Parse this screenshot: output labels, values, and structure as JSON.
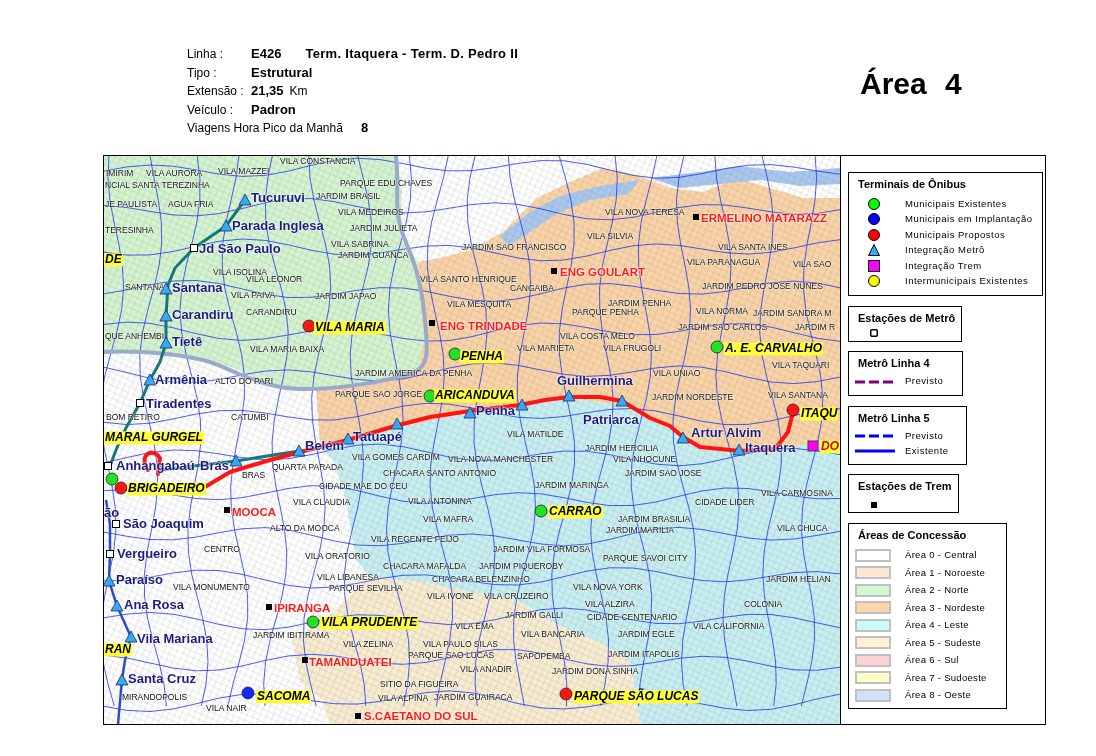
{
  "header": {
    "rows": [
      {
        "label": "Linha :",
        "value": "E426",
        "detail": "Term. Itaquera - Term. D. Pedro II"
      },
      {
        "label": "Tipo :",
        "value": "Estrutural"
      },
      {
        "label": "Extensão :",
        "value": "21,35",
        "unit": "Km"
      },
      {
        "label": "Veículo :",
        "value": "Padron"
      },
      {
        "label": "Viagens Hora Pico da Manhã",
        "value": "8"
      }
    ]
  },
  "area_title": "Área 4",
  "map": {
    "neighborhoods": [
      "VILA CONSTANCIA",
      "IMIRIM",
      "VILA AURORA",
      "VILA MAZZEI",
      "NCIAL SANTA TEREZINHA",
      "PARQUE EDU CHAVES",
      "JARDIM BRASIL",
      "JE PAULISTA",
      "AGUA FRIA",
      "VILA MEDEIROS",
      "VILA NOVA TERESA",
      "TERESINHA",
      "JARDIM JULIETA",
      "VILA SILVIA",
      "VILA SABRINA",
      "JARDIM SAO FRANCISCO",
      "VILA SANTA INES",
      "JARDIM GUANCA",
      "VILA PARANAGUA",
      "VILA SAO",
      "VILA ISOLINA",
      "VILA LEONOR",
      "VILA SANTO HENRIQUE",
      "SANTANA",
      "CANGAIBA",
      "JARDIM PEDRO JOSE NUNES",
      "VILA PAIVA",
      "JARDIM JAPAO",
      "VILA MESQUITA",
      "JARDIM PENHA",
      "CARANDIRU",
      "PARQUE PENHA",
      "VILA NORMA",
      "JARDIM SANDRA M",
      "JARDIM SAO CARLOS",
      "JARDIM R",
      "QUE ANHEMBI",
      "VILA COSTA MELO",
      "VILA MARIA BAIXA",
      "VILA MARIETA",
      "VILA FRUGOLI",
      "VILA TAQUARI",
      "JARDIM AMERICA DA PENHA",
      "VILA UNIAO",
      "ALTO DO PARI",
      "PARQUE SAO JORGE",
      "JARDIM NORDESTE",
      "VILA SANTANA",
      "BOM RETIRO",
      "CATUMBI",
      "VILA MATILDE",
      "JARDIM HERCILIA",
      "VILA GOMES CARDIM",
      "VILA NOVA MANCHESTER",
      "VILA NHOCUNE",
      "QUARTA PARADA",
      "BRAS",
      "CHACARA SANTO ANTONIO",
      "JARDIM SAO JOSE",
      "CIDADE MAE DO CEU",
      "JARDIM MARINGA",
      "VILA CARMOSINA",
      "VILA CLAUDIA",
      "VILA ANTONINA",
      "CIDADE LIDER",
      "VILA MAFRA",
      "JARDIM BRASILIA",
      "ALTO DA MOOCA",
      "JARDIM MARILIA",
      "VILA CHUCA",
      "VILA REGENTE FEIJO",
      "CENTRO",
      "JARDIM VILA FORMOSA",
      "VILA ORATORIO",
      "PARQUE SAVOI CITY",
      "CHACARA MAFALDA",
      "JARDIM PIQUEROBY",
      "VILA LIBANESA",
      "CHACARA BELENZINHO",
      "JARDIM HELIAN",
      "VILA MONUMENTO",
      "PARQUE SEVILHA",
      "VILA NOVA YORK",
      "VILA IVONE",
      "VILA CRUZEIRO",
      "VILA ALZIRA",
      "COLONIA",
      "JARDIM GALLI",
      "CIDADE CENTENARIO",
      "VILA EMA",
      "VILA CALIFORNIA",
      "JARDIM IBITIRAMA",
      "VILA BANCARIA",
      "JARDIM EGLE",
      "VILA ZELINA",
      "VILA PAULO SILAS",
      "PARQUE SAO LUCAS",
      "SAPOPEMBA",
      "JARDIM ITAPOLIS",
      "VILA ANADIR",
      "JARDIM DONA SINHA",
      "SITIO DA FIGUEIRA",
      "MIRANDOPOLIS",
      "VILA ALPINA",
      "JARDIM GUAIRACA",
      "VILA NAIR"
    ],
    "metro_stations": [
      {
        "name": "Tucuruvi",
        "kind": "integration"
      },
      {
        "name": "Parada Inglesa",
        "kind": "integration"
      },
      {
        "name": "Jd São Paulo",
        "kind": "station"
      },
      {
        "name": "Santana",
        "kind": "integration"
      },
      {
        "name": "Carandiru",
        "kind": "integration"
      },
      {
        "name": "Tietê",
        "kind": "integration"
      },
      {
        "name": "Armênia",
        "kind": "integration"
      },
      {
        "name": "Tiradentes",
        "kind": "station"
      },
      {
        "name": "Anhangabaú",
        "kind": "station"
      },
      {
        "name": "Brás",
        "kind": "integration"
      },
      {
        "name": "Belém",
        "kind": "integration"
      },
      {
        "name": "Tatuapé",
        "kind": "integration"
      },
      {
        "name": "Penha",
        "kind": "integration"
      },
      {
        "name": "Guilhermina",
        "kind": "integration"
      },
      {
        "name": "Patriarca",
        "kind": "integration"
      },
      {
        "name": "Artur Alvim",
        "kind": "integration"
      },
      {
        "name": "Itaquera",
        "kind": "integration"
      },
      {
        "name": "ão",
        "kind": "none"
      },
      {
        "name": "São Joaquim",
        "kind": "station"
      },
      {
        "name": "Vergueiro",
        "kind": "station"
      },
      {
        "name": "Paraíso",
        "kind": "integration"
      },
      {
        "name": "Ana Rosa",
        "kind": "integration"
      },
      {
        "name": "Vila Mariana",
        "kind": "integration"
      },
      {
        "name": "Santa Cruz",
        "kind": "integration"
      },
      {
        "kind": "integration"
      },
      {
        "kind": "integration"
      }
    ],
    "terminals": [
      {
        "name": "DE",
        "kind": "none"
      },
      {
        "name": "VILA MARIA",
        "kind": "proposed"
      },
      {
        "name": "A. E. CARVALHO",
        "kind": "existing"
      },
      {
        "name": "PENHA",
        "kind": "existing"
      },
      {
        "name": "ARICANDUVA",
        "kind": "existing"
      },
      {
        "name": "ITAQU",
        "kind": "proposed"
      },
      {
        "name": "MARAL GURGEL",
        "kind": "none"
      },
      {
        "name": "DO",
        "kind": "train"
      },
      {
        "kind": "existing"
      },
      {
        "name": "BRIGADEIRO",
        "kind": "proposed"
      },
      {
        "name": "CARRAO",
        "kind": "existing"
      },
      {
        "name": "VILA PRUDENTE",
        "kind": "existing"
      },
      {
        "name": "RAN",
        "kind": "none"
      },
      {
        "name": "SACOMA",
        "kind": "implantation"
      },
      {
        "name": "PARQUE SÃO LUCAS",
        "kind": "proposed"
      }
    ],
    "train_stations": [
      "ERMELINO MATARAZZ",
      "ENG GOULART",
      "ENG TRINDADE",
      "MOOCA",
      "IPIRANGA",
      "TAMANDUATEI",
      "S.CAETANO DO SUL"
    ]
  },
  "legend": [
    {
      "kind": "symbols",
      "title": "Terminais de Ônibus",
      "items": [
        {
          "label": "Municipais Existentes",
          "kind": "circle",
          "color": "#00ff00"
        },
        {
          "label": "Municipais em Implantação",
          "kind": "circle",
          "color": "#0000ff"
        },
        {
          "label": "Municipais Propostos",
          "kind": "circle",
          "color": "#ff0000"
        },
        {
          "label": "Integração Metrô",
          "kind": "triangle",
          "color": "#33aaff"
        },
        {
          "label": "Integração Trem",
          "kind": "square",
          "color": "#ff00ff"
        },
        {
          "label": "Intermunicipais Existentes",
          "kind": "circle",
          "color": "#ffff00"
        }
      ]
    },
    {
      "kind": "metro_station",
      "title": "Estações de Metrô"
    },
    {
      "kind": "lines",
      "title": "Metrô Linha 4",
      "items": [
        {
          "label": "Previsto",
          "kind": "dashed",
          "color": "#800080"
        }
      ]
    },
    {
      "kind": "lines",
      "title": "Metrô Linha 5",
      "items": [
        {
          "label": "Previsto",
          "kind": "dashed",
          "color": "#0000ff"
        },
        {
          "label": "Existente",
          "kind": "solid",
          "color": "#0000ff"
        }
      ]
    },
    {
      "kind": "train_station",
      "title": "Estações de Trem"
    },
    {
      "kind": "areas",
      "title": "Áreas de Concessão",
      "items": [
        {
          "label": "Área 0 - Central",
          "color": "#ffffff"
        },
        {
          "label": "Área 1 - Noroeste",
          "color": "#fde6d2"
        },
        {
          "label": "Área 2 - Norte",
          "color": "#d2fad2"
        },
        {
          "label": "Área 3 - Nordeste",
          "color": "#fdd5a8"
        },
        {
          "label": "Área 4 - Leste",
          "color": "#ccfafa"
        },
        {
          "label": "Área 5 - Sudeste",
          "color": "#fdf2d4"
        },
        {
          "label": "Área 6 - Sul",
          "color": "#fdd2d4"
        },
        {
          "label": "Área 7 - Sudoeste",
          "color": "#fdfdc8"
        },
        {
          "label": "Área 8 - Oeste",
          "color": "#d2e0f8"
        }
      ]
    }
  ]
}
